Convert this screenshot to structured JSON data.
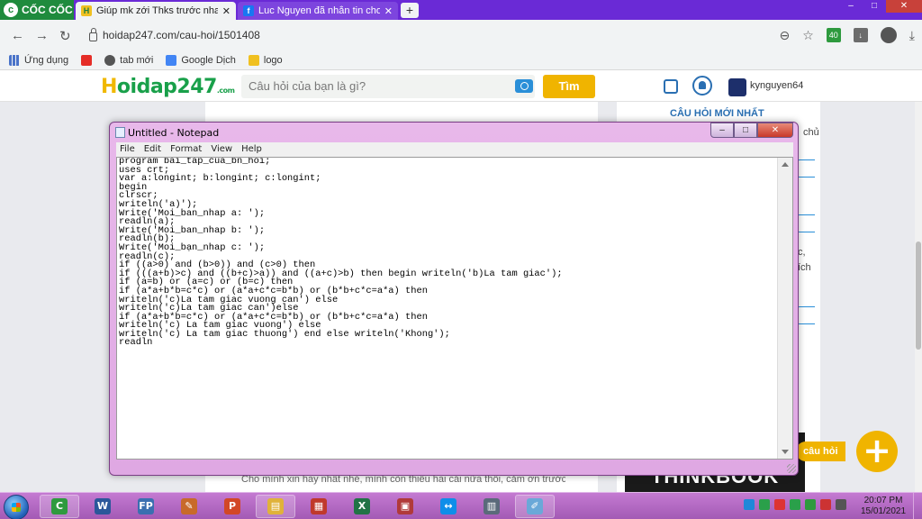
{
  "browser": {
    "brand": "CỐC CỐC",
    "tabs": [
      {
        "title": "Giúp mk zới Thks trước nha! ¢",
        "close": "✕",
        "favicon": "H"
      },
      {
        "title": "Luc Nguyen đã nhắn tin cho b",
        "close": "✕",
        "favicon": "f"
      }
    ],
    "new_tab": "+",
    "window_buttons": {
      "minimize": "–",
      "maximize": "□",
      "close": "✕"
    },
    "url": "hoidap247.com/cau-hoi/1501408",
    "extension_badge": "40",
    "bookmarks": [
      {
        "label": "Ứng dụng",
        "color": "#4a73c9"
      },
      {
        "label": "",
        "color": "#e52d27"
      },
      {
        "label": "tab mới",
        "color": "#555555"
      },
      {
        "label": "Google Dịch",
        "color": "#4285f4"
      },
      {
        "label": "logo",
        "color": "#f0c020"
      }
    ]
  },
  "site": {
    "logo_h": "H",
    "logo_rest": "oidap247",
    "logo_sub": ".com",
    "search_placeholder": "Câu hỏi của bạn là gì?",
    "search_button": "Tìm",
    "username": "kynguyen64",
    "sidebar_title": "CÂU HỎI MỚI NHẤT",
    "sidebar_fragments": [
      "chủ",
      "c,",
      "ích"
    ],
    "ad_text": "THINKBOOK",
    "bottom_text": "Cho mình xin hay nhất nhé, mình còn thiếu hai cái nữa thôi, cảm ơn trước.",
    "ask_label": "câu hỏi",
    "ask_button": "+"
  },
  "notepad": {
    "title": "Untitled - Notepad",
    "buttons": {
      "minimize": "–",
      "maximize": "□",
      "close": "✕"
    },
    "menu": [
      "File",
      "Edit",
      "Format",
      "View",
      "Help"
    ],
    "content": "program bai_tap_cua_bn_hoi;\nuses crt;\nvar a:longint; b:longint; c:longint;\nbegin\nclrscr;\nwriteln('a)');\nWrite('Moi_ban_nhap a: ');\nreadln(a);\nWrite('Moi_ban_nhap b: ');\nreadln(b);\nWrite('Moi_bạn_nhap c: ');\nreadln(c);\nif ((a>0) and (b>0)) and (c>0) then\nif (((a+b)>c) and ((b+c)>a)) and ((a+c)>b) then begin writeln('b)La tam giac');\nif (a=b) or (a=c) or (b=c) then\nif (a*a+b*b=c*c) or (a*a+c*c=b*b) or (b*b+c*c=a*a) then\nwriteln('c)La tam giac vuong can') else\nwriteln('c)La tam giac can')else\nif (a*a+b*b=c*c) or (a*a+c*c=b*b) or (b*b+c*c=a*a) then\nwriteln('c) La tam giac vuong') else\nwriteln('c) La tam giac thuong') end else writeln('Khong');\nreadln"
  },
  "taskbar": {
    "apps": [
      {
        "name": "coccoc",
        "glyph": "C",
        "color": "#2e9a3e",
        "open": true
      },
      {
        "name": "word",
        "glyph": "W",
        "color": "#2b579a",
        "open": false
      },
      {
        "name": "free-pascal",
        "glyph": "FP",
        "color": "#3a6fb0",
        "open": false
      },
      {
        "name": "paint",
        "glyph": "✎",
        "color": "#c86a2a",
        "open": false
      },
      {
        "name": "powerpoint",
        "glyph": "P",
        "color": "#d24726",
        "open": false
      },
      {
        "name": "explorer",
        "glyph": "▤",
        "color": "#e0b23a",
        "open": true
      },
      {
        "name": "app-grid",
        "glyph": "▦",
        "color": "#c0392b",
        "open": false
      },
      {
        "name": "excel",
        "glyph": "X",
        "color": "#217346",
        "open": false
      },
      {
        "name": "media",
        "glyph": "▣",
        "color": "#b03a3a",
        "open": false
      },
      {
        "name": "teamviewer",
        "glyph": "↔",
        "color": "#0e8ee9",
        "open": false
      },
      {
        "name": "calculator",
        "glyph": "▥",
        "color": "#5a6a7a",
        "open": false
      },
      {
        "name": "notepad",
        "glyph": "✐",
        "color": "#6aa8d8",
        "open": true
      }
    ],
    "tray_colors": [
      "#1f88d9",
      "#2aa04a",
      "#d33",
      "#2aa04a",
      "#2e9a3e",
      "#c33",
      "#555"
    ],
    "time": "20:07 PM",
    "date": "15/01/2021"
  }
}
